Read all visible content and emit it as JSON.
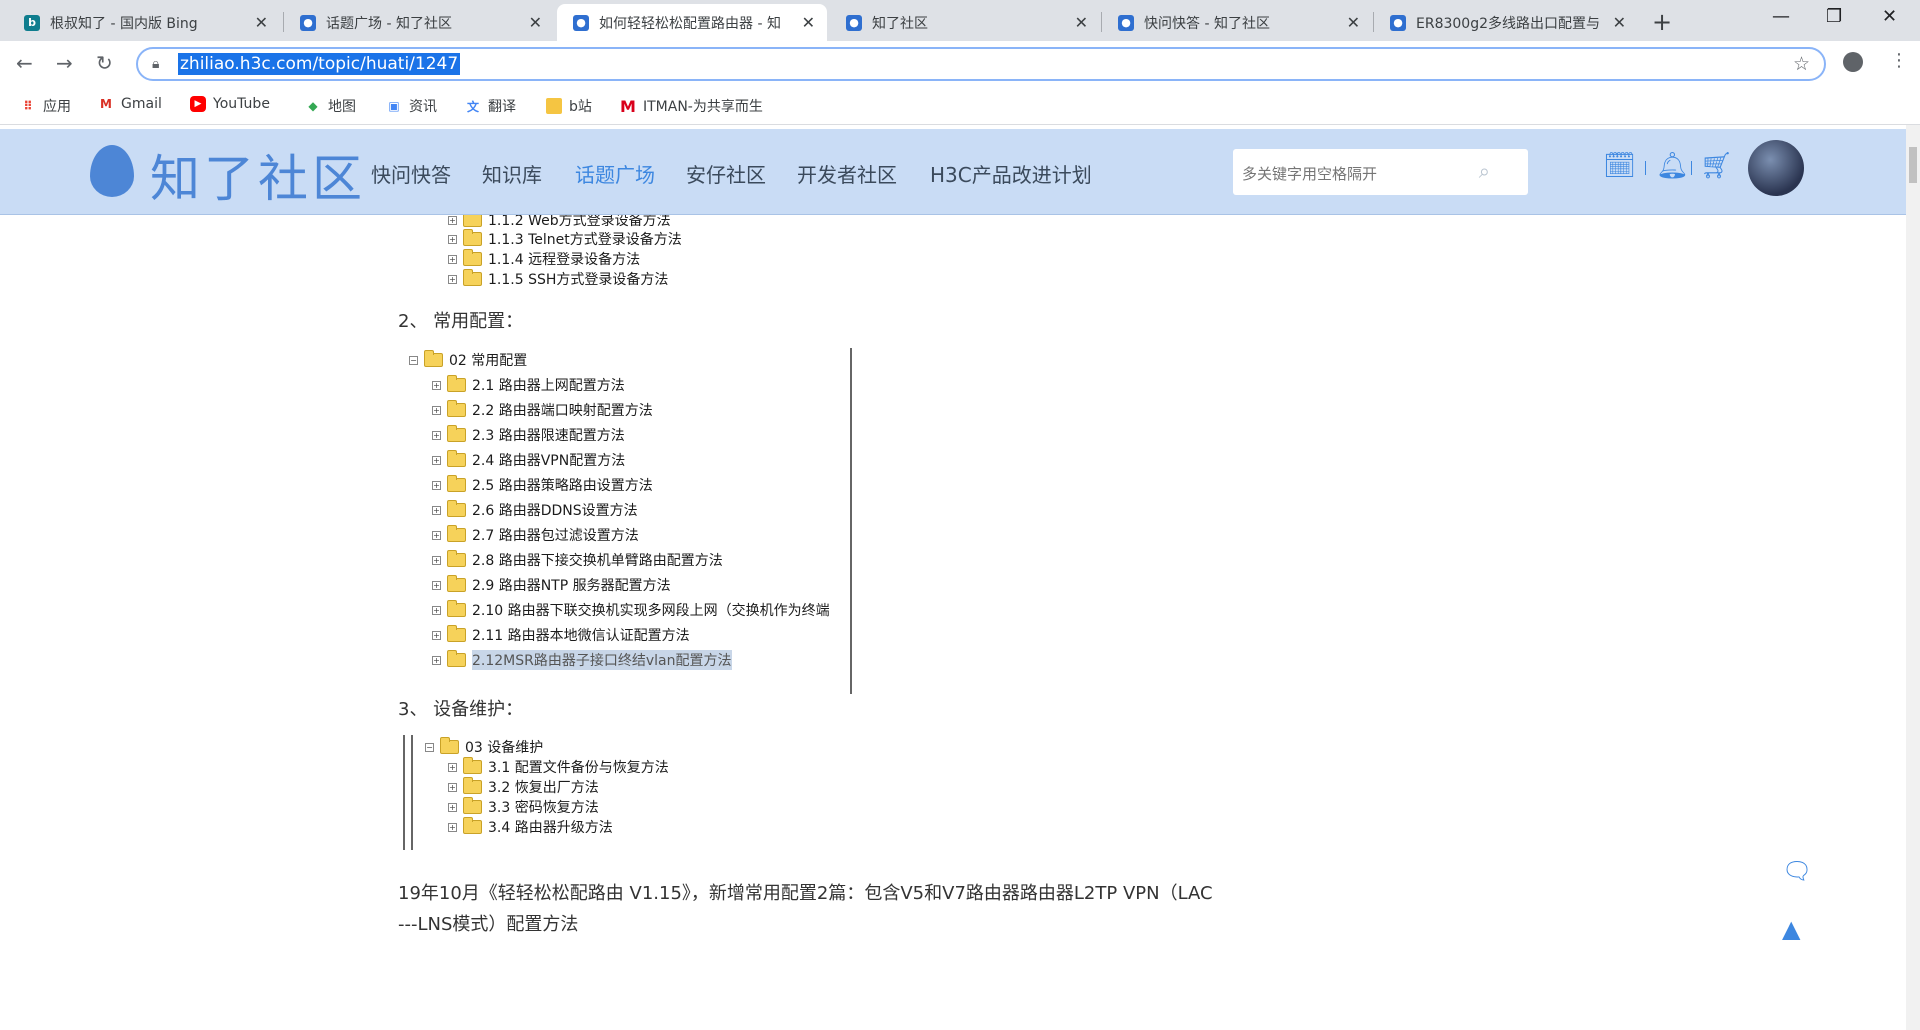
{
  "browser": {
    "tabs": [
      {
        "title": "根叔知了 - 国内版 Bing",
        "favicon": "bing-icon",
        "color": "#0f7d8e",
        "active": false
      },
      {
        "title": "话题广场 - 知了社区",
        "favicon": "zhiliao-icon",
        "color": "#2f6fd0",
        "active": false
      },
      {
        "title": "如何轻轻松松配置路由器 - 知",
        "favicon": "zhiliao-icon",
        "color": "#2f6fd0",
        "active": true
      },
      {
        "title": "知了社区",
        "favicon": "zhiliao-icon",
        "color": "#2f6fd0",
        "active": false
      },
      {
        "title": "快问快答 - 知了社区",
        "favicon": "zhiliao-icon",
        "color": "#2f6fd0",
        "active": false
      },
      {
        "title": "ER8300g2多线路出口配置与",
        "favicon": "zhiliao-icon",
        "color": "#2f6fd0",
        "active": false
      }
    ],
    "new_tab": "+",
    "url": "zhiliao.h3c.com/topic/huati/1247",
    "bookmarks": [
      {
        "label": "应用",
        "icon": "apps-grid-icon"
      },
      {
        "label": "Gmail",
        "icon": "gmail-icon"
      },
      {
        "label": "YouTube",
        "icon": "youtube-icon"
      },
      {
        "label": "地图",
        "icon": "maps-icon"
      },
      {
        "label": "资讯",
        "icon": "news-icon"
      },
      {
        "label": "翻译",
        "icon": "translate-icon"
      },
      {
        "label": "b站",
        "icon": "folder-icon"
      },
      {
        "label": "ITMAN-为共享而生",
        "icon": "itman-icon"
      }
    ]
  },
  "site": {
    "logo_text": "知了社区",
    "nav": [
      {
        "label": "快问快答",
        "active": false
      },
      {
        "label": "知识库",
        "active": false
      },
      {
        "label": "话题广场",
        "active": true
      },
      {
        "label": "安仔社区",
        "active": false
      },
      {
        "label": "开发者社区",
        "active": false
      },
      {
        "label": "H3C产品改进计划",
        "active": false
      }
    ],
    "search_placeholder": "多关键字用空格隔开",
    "accent": "#3d87e0",
    "header_bg": "#c9dcf5"
  },
  "content": {
    "tree1_items": [
      "1.1.2 Web方式登录设备方法",
      "1.1.3 Telnet方式登录设备方法",
      "1.1.4 远程登录设备方法",
      "1.1.5 SSH方式登录设备方法"
    ],
    "section2_heading": "2、  常用配置：",
    "tree2_root": "02 常用配置",
    "tree2_items": [
      "2.1 路由器上网配置方法",
      "2.2 路由器端口映射配置方法",
      "2.3 路由器限速配置方法",
      "2.4 路由器VPN配置方法",
      "2.5 路由器策略路由设置方法",
      "2.6 路由器DDNS设置方法",
      "2.7 路由器包过滤设置方法",
      "2.8 路由器下接交换机单臂路由配置方法",
      "2.9 路由器NTP 服务器配置方法",
      "2.10 路由器下联交换机实现多网段上网（交换机作为终端",
      "2.11 路由器本地微信认证配置方法",
      "2.12MSR路由器子接口终结vlan配置方法"
    ],
    "section3_heading": "3、  设备维护：",
    "tree3_root": "03 设备维护",
    "tree3_items": [
      "3.1 配置文件备份与恢复方法",
      "3.2 恢复出厂方法",
      "3.3 密码恢复方法",
      "3.4 路由器升级方法"
    ],
    "update_line1": "19年10月《轻轻松松配路由 V1.15》，新增常用配置2篇：包含V5和V7路由器路由器L2TP VPN（LAC",
    "update_line2": "---LNS模式）配置方法"
  }
}
